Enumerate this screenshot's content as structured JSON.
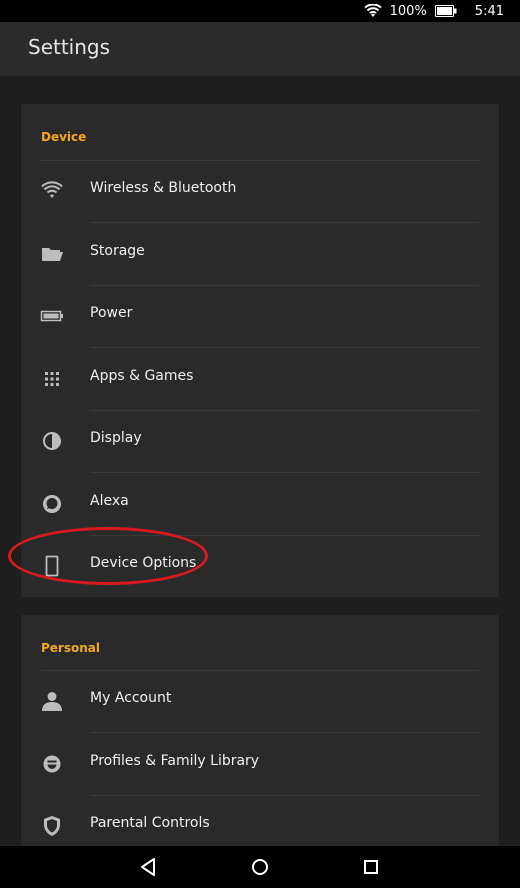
{
  "status_bar": {
    "battery_text": "100%",
    "time": "5:41"
  },
  "app_bar": {
    "title": "Settings"
  },
  "sections": {
    "device": {
      "header": "Device",
      "items": [
        {
          "label": "Wireless & Bluetooth",
          "icon": "wifi-icon"
        },
        {
          "label": "Storage",
          "icon": "folder-icon"
        },
        {
          "label": "Power",
          "icon": "battery-icon"
        },
        {
          "label": "Apps & Games",
          "icon": "grid-icon"
        },
        {
          "label": "Display",
          "icon": "contrast-icon"
        },
        {
          "label": "Alexa",
          "icon": "alexa-icon"
        },
        {
          "label": "Device Options",
          "icon": "device-icon"
        }
      ]
    },
    "personal": {
      "header": "Personal",
      "items": [
        {
          "label": "My Account",
          "icon": "person-icon"
        },
        {
          "label": "Profiles & Family Library",
          "icon": "face-icon"
        },
        {
          "label": "Parental Controls",
          "icon": "shield-icon"
        }
      ]
    }
  },
  "colors": {
    "accent": "#f5a623",
    "highlight": "#d71920"
  }
}
